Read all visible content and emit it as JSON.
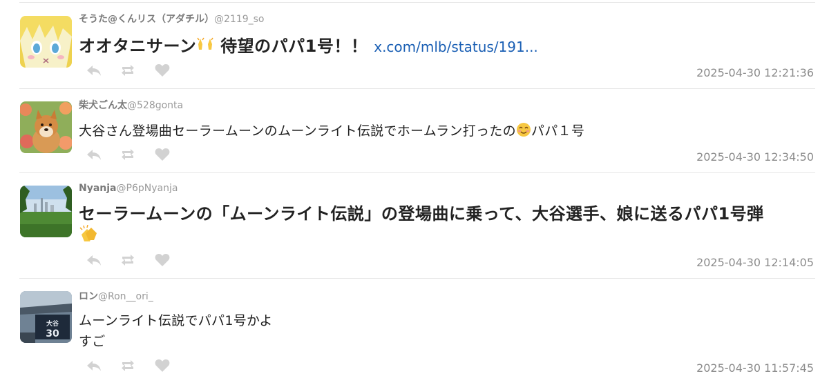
{
  "colors": {
    "name": "#7a7a7a",
    "handle": "#9a9a9a",
    "text": "#222222",
    "link": "#1a5fb4",
    "icon": "#d2d2d2",
    "timestamp": "#8c8c8c",
    "divider": "#e6e6e6"
  },
  "tweets": [
    {
      "username": "そうた@くんリス（アダチル）",
      "handle": "@2119_so",
      "text": "オオタニサーン",
      "emoji": "raising-hands",
      "text2": " 待望のパパ1号！！ ",
      "link": "x.com/mlb/status/191...",
      "timestamp": "2025-04-30 12:21:36",
      "avatar_icon": "anime-girl-avatar"
    },
    {
      "username": "柴犬ごん太",
      "handle": "@528gonta",
      "text": "大谷さん登場曲セーラームーンのムーンライト伝説でホームラン打ったの",
      "emoji": "smiling-face",
      "text2": "パパ１号",
      "timestamp": "2025-04-30 12:34:50",
      "avatar_icon": "shiba-dog-avatar"
    },
    {
      "username": "Nyanja",
      "handle": "@P6pNyanja",
      "text": "セーラームーンの「ムーンライト伝説」の登場曲に乗って、大谷選手、娘に送るパパ1号弾",
      "emoji": "clapping-hands",
      "timestamp": "2025-04-30 12:14:05",
      "avatar_icon": "park-city-avatar"
    },
    {
      "username": "ロン",
      "handle": "@Ron__ori_",
      "text_line1": "ムーンライト伝説でパパ1号かよ",
      "text_line2": "すご",
      "timestamp": "2025-04-30 11:57:45",
      "avatar_icon": "stadium-banner-avatar"
    }
  ],
  "action_icons": [
    "reply-icon",
    "retweet-icon",
    "like-icon"
  ]
}
